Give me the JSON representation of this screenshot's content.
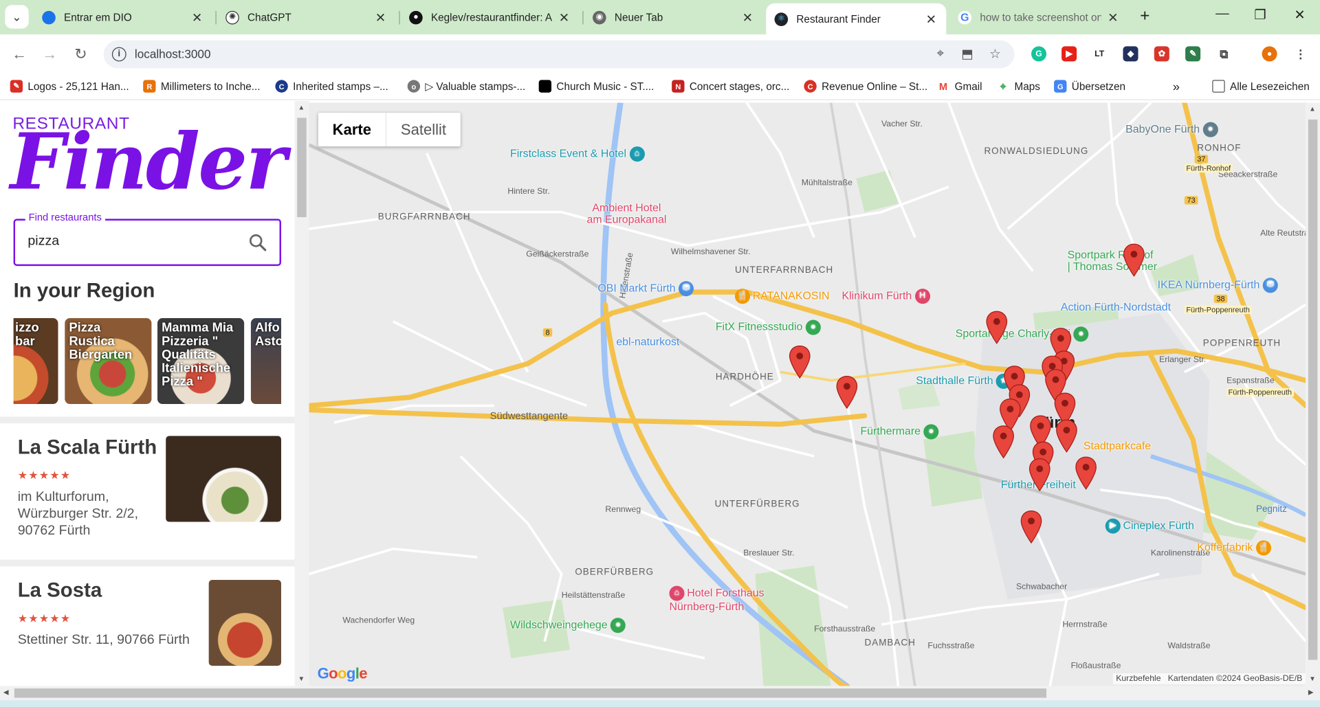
{
  "browser": {
    "tabs": [
      {
        "label": "Entrar em DIO",
        "icon": "dio-icon",
        "color": "#1a73e8"
      },
      {
        "label": "ChatGPT",
        "icon": "chatgpt-icon",
        "color": "#333333"
      },
      {
        "label": "Keglev/restaurantfinder: Ap",
        "icon": "github-icon",
        "color": "#111111"
      },
      {
        "label": "Neuer Tab",
        "icon": "chrome-icon",
        "color": "#555555"
      },
      {
        "label": "Restaurant Finder",
        "icon": "react-icon",
        "color": "#61dafb",
        "active": true
      },
      {
        "label": "how to take screenshot on",
        "icon": "google-icon",
        "color": "#4285f4"
      }
    ],
    "address": "localhost:3000",
    "bookmarks": [
      {
        "label": "Logos - 25,121 Han...",
        "color": "#d93025"
      },
      {
        "label": "Millimeters to Inche...",
        "color": "#e8710a"
      },
      {
        "label": "Inherited stamps –...",
        "color": "#1a3a8a"
      },
      {
        "label": "▷ Valuable stamps-...",
        "color": "#777777"
      },
      {
        "label": "Church Music - ST....",
        "color": "#000000"
      },
      {
        "label": "Concert stages, orc...",
        "color": "#c5221f"
      },
      {
        "label": "Revenue Online – St...",
        "color": "#d93025"
      },
      {
        "label": "Gmail",
        "color": "#ea4335"
      },
      {
        "label": "Maps",
        "color": "#34a853"
      },
      {
        "label": "Übersetzen",
        "color": "#4285f4"
      }
    ],
    "all_bookmarks": "Alle Lesezeichen"
  },
  "app": {
    "brand_top": "RESTAURANT",
    "brand_script": "Finder",
    "search": {
      "legend": "Find restaurants",
      "value": "pizza"
    },
    "region_title": "In your Region",
    "region_cards": [
      {
        "title": "izzo\nbar"
      },
      {
        "title": "Pizza\nRustica\nBiergarten"
      },
      {
        "title": "Mamma Mia\nPizzeria \"\nQualitäts\nItalienische\nPizza \""
      },
      {
        "title": "Alfo\nAsto"
      }
    ],
    "results": [
      {
        "name": "La Scala Fürth",
        "stars": "★★★★★",
        "address": "im Kulturforum,\nWürzburger Str. 2/2,\n90762 Fürth"
      },
      {
        "name": "La Sosta",
        "stars": "★★★★★",
        "address": "Stettiner Str. 11, 90766 Fürth"
      }
    ]
  },
  "map": {
    "type_buttons": [
      "Karte",
      "Satellit"
    ],
    "districts": [
      "BURGFARRNBACH",
      "UNTERFARRNBACH",
      "HARDHÖHE",
      "UNTERFÜRBERG",
      "OBERFÜRBERG",
      "DAMBACH",
      "RONWALDSIEDLUNG",
      "RONHOF",
      "POPPENREUTH"
    ],
    "city": "Fürth",
    "pois": [
      {
        "label": "Firstclass Event & Hotel",
        "color": "#1a9bb0"
      },
      {
        "label": "Ambient Hotel\nam Europakanal",
        "color": "#e0466a"
      },
      {
        "label": "OBI Markt Fürth",
        "color": "#4a8fe0"
      },
      {
        "label": "RATANAKOSIN",
        "color": "#f29900"
      },
      {
        "label": "Klinikum Fürth",
        "color": "#e0466a"
      },
      {
        "label": "FitX Fitnessstudio",
        "color": "#34a853"
      },
      {
        "label": "ebl-naturkost",
        "color": "#4a8fe0"
      },
      {
        "label": "Stadthalle Fürth",
        "color": "#1a9bb0"
      },
      {
        "label": "Sportanlage Charly-Mai",
        "color": "#34a853"
      },
      {
        "label": "Fürthermare",
        "color": "#34a853"
      },
      {
        "label": "Sportpark Ronhof\n| Thomas Sommer",
        "color": "#34a853"
      },
      {
        "label": "IKEA Nürnberg-Fürth",
        "color": "#4a8fe0"
      },
      {
        "label": "Action Fürth-Nordstadt",
        "color": "#4a8fe0"
      },
      {
        "label": "BabyOne Fürth",
        "color": "#607d8b"
      },
      {
        "label": "Stadtparkcafe",
        "color": "#f29900"
      },
      {
        "label": "Cineplex Fürth",
        "color": "#1a9bb0"
      },
      {
        "label": "Kofferfabrik",
        "color": "#f29900"
      },
      {
        "label": "Hotel Forsthaus\nNürnberg-Fürth",
        "color": "#e0466a"
      },
      {
        "label": "Wildschweingehege",
        "color": "#34a853"
      },
      {
        "label": "Fürther Freiheit",
        "color": "#1a9bb0"
      }
    ],
    "streets": [
      "Südwesttangente",
      "Hintere Str.",
      "Geißäckerstraße",
      "Wilhelmshavener Str.",
      "Hafenstraße",
      "Rennweg",
      "Breslauer Str.",
      "Heilstättenstraße",
      "Forsthausstraße",
      "Fuchsstraße",
      "Karolinenstraße",
      "Herrnstraße",
      "Erlanger Str.",
      "Seeackerstraße",
      "Espanstraße",
      "Alte Reutstraße",
      "Vacher Str.",
      "Mühltalstraße",
      "Pegnitz",
      "Wachendorfer Weg",
      "Schwabacher",
      "Floßaustraße",
      "Waldstraße"
    ],
    "shields": [
      "8",
      "73",
      "37",
      "38"
    ],
    "shield_labels": [
      "Fürth-Ronhof",
      "Fürth-Poppenreuth",
      "Fürth-Poppenreuth"
    ],
    "google": "Google",
    "shortcuts": "Kurzbefehle",
    "attribution": "Kartendaten ©2024 GeoBasis-DE/B",
    "colors": {
      "marker": "#e8453c",
      "highway": "#f7c64a",
      "water": "#9fc4f5",
      "park": "#cfe8c8"
    }
  }
}
